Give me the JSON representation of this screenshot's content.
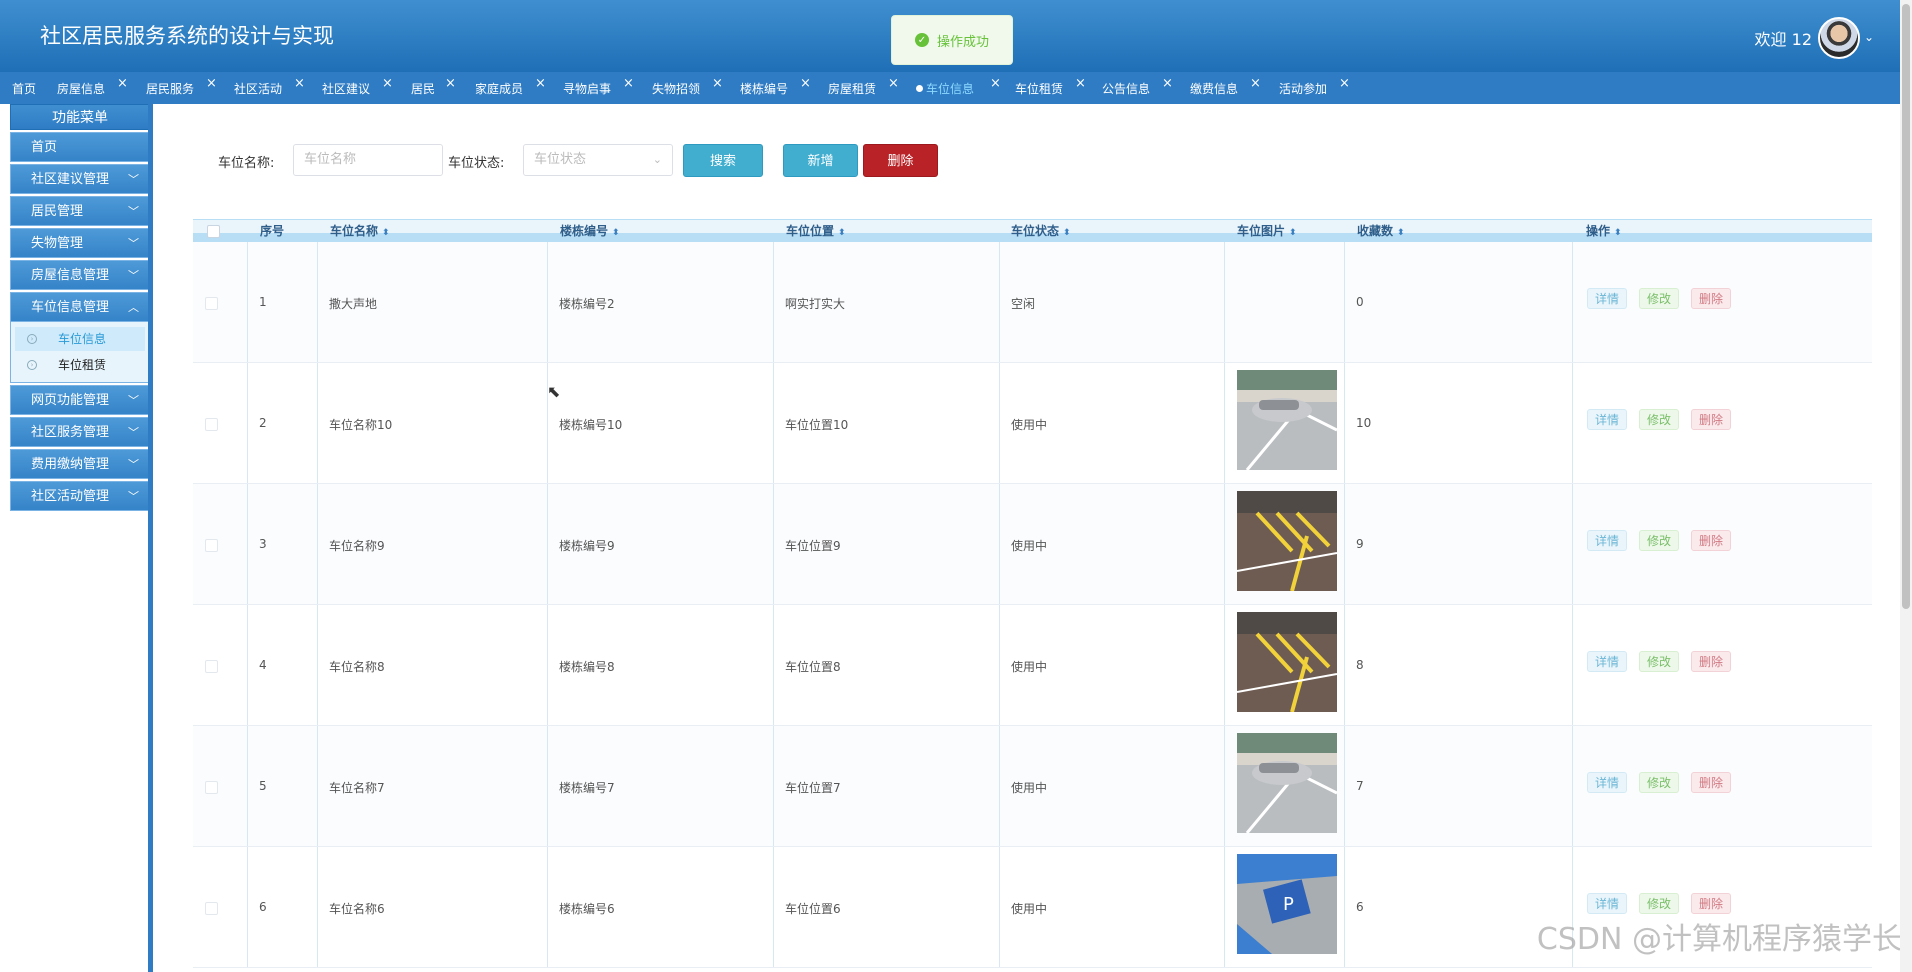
{
  "app": {
    "title": "社区居民服务系统的设计与实现",
    "welcome": "欢迎 12"
  },
  "toast": {
    "text": "操作成功"
  },
  "tabs": [
    {
      "label": "首页",
      "closable": false
    },
    {
      "label": "房屋信息",
      "closable": true
    },
    {
      "label": "居民服务",
      "closable": true
    },
    {
      "label": "社区活动",
      "closable": true
    },
    {
      "label": "社区建议",
      "closable": true
    },
    {
      "label": "居民",
      "closable": true
    },
    {
      "label": "家庭成员",
      "closable": true
    },
    {
      "label": "寻物启事",
      "closable": true
    },
    {
      "label": "失物招领",
      "closable": true
    },
    {
      "label": "楼栋编号",
      "closable": true
    },
    {
      "label": "房屋租赁",
      "closable": true
    },
    {
      "label": "车位信息",
      "closable": true,
      "active": true
    },
    {
      "label": "车位租赁",
      "closable": true
    },
    {
      "label": "公告信息",
      "closable": true
    },
    {
      "label": "缴费信息",
      "closable": true
    },
    {
      "label": "活动参加",
      "closable": true
    }
  ],
  "sidebar": {
    "title": "功能菜单",
    "items": [
      {
        "label": "首页"
      },
      {
        "label": "社区建议管理"
      },
      {
        "label": "居民管理"
      },
      {
        "label": "失物管理"
      },
      {
        "label": "房屋信息管理"
      },
      {
        "label": "车位信息管理",
        "expanded": true,
        "children": [
          {
            "label": "车位信息",
            "active": true
          },
          {
            "label": "车位租赁"
          }
        ]
      },
      {
        "label": "网页功能管理"
      },
      {
        "label": "社区服务管理"
      },
      {
        "label": "费用缴纳管理"
      },
      {
        "label": "社区活动管理"
      }
    ]
  },
  "search": {
    "name_label": "车位名称:",
    "name_placeholder": "车位名称",
    "status_label": "车位状态:",
    "status_placeholder": "车位状态",
    "search_button": "搜索",
    "add_button": "新增",
    "delete_button": "删除"
  },
  "table": {
    "columns": [
      "序号",
      "车位名称",
      "楼栋编号",
      "车位位置",
      "车位状态",
      "车位图片",
      "收藏数",
      "操作"
    ],
    "actions": {
      "detail": "详情",
      "edit": "修改",
      "delete": "删除"
    },
    "rows": [
      {
        "index": "1",
        "name": "撒大声地",
        "building": "楼栋编号2",
        "location": "啊实打实大",
        "status": "空闲",
        "image": "",
        "favorites": "0"
      },
      {
        "index": "2",
        "name": "车位名称10",
        "building": "楼栋编号10",
        "location": "车位位置10",
        "status": "使用中",
        "image": "parking-car",
        "favorites": "10"
      },
      {
        "index": "3",
        "name": "车位名称9",
        "building": "楼栋编号9",
        "location": "车位位置9",
        "status": "使用中",
        "image": "parking-yellow-lines",
        "favorites": "9"
      },
      {
        "index": "4",
        "name": "车位名称8",
        "building": "楼栋编号8",
        "location": "车位位置8",
        "status": "使用中",
        "image": "parking-yellow-lines",
        "favorites": "8"
      },
      {
        "index": "5",
        "name": "车位名称7",
        "building": "楼栋编号7",
        "location": "车位位置7",
        "status": "使用中",
        "image": "parking-car",
        "favorites": "7"
      },
      {
        "index": "6",
        "name": "车位名称6",
        "building": "楼栋编号6",
        "location": "车位位置6",
        "status": "使用中",
        "image": "parking-blue-p",
        "favorites": "6"
      }
    ]
  },
  "watermark": "CSDN @计算机程序猿学长"
}
